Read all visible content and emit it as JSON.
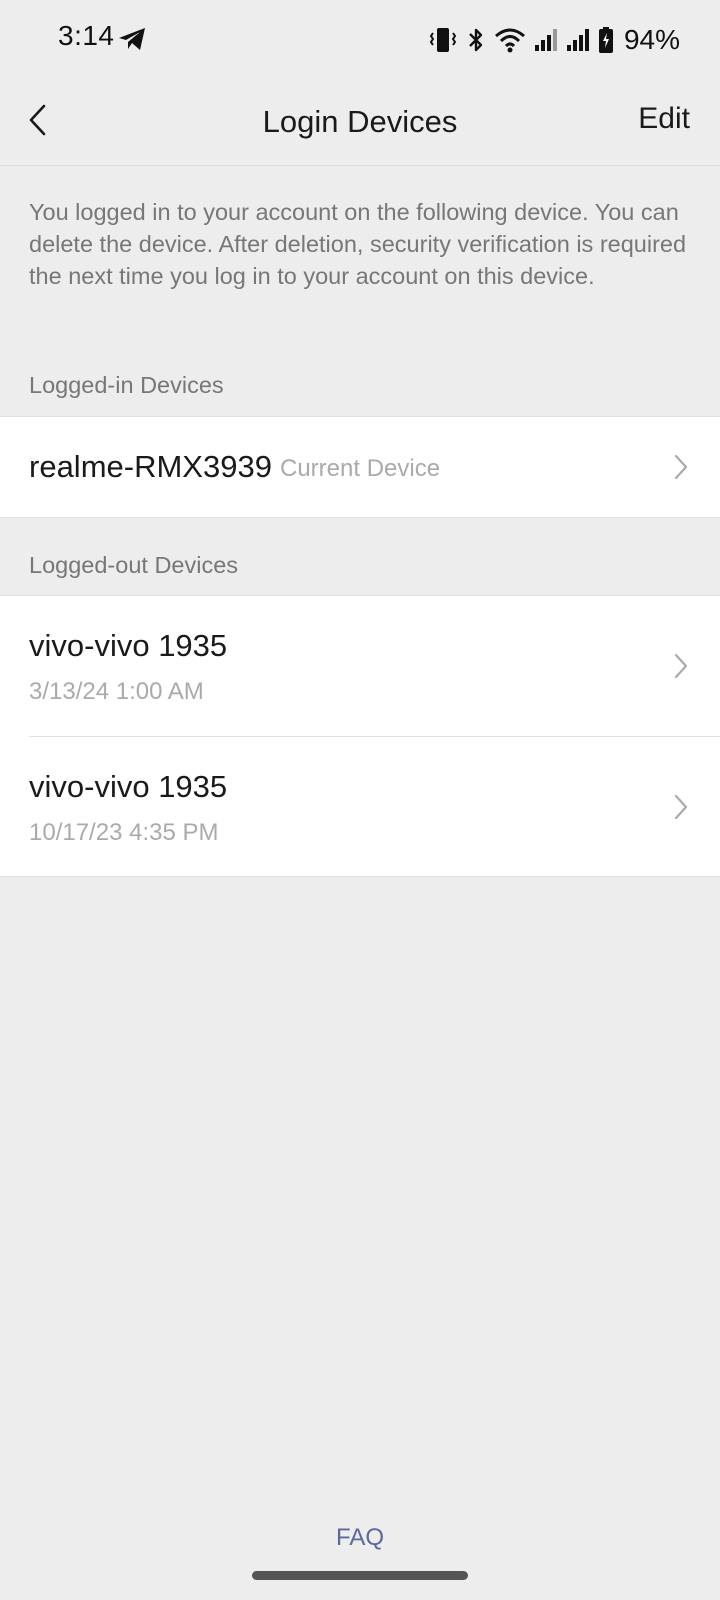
{
  "status_bar": {
    "time": "3:14",
    "battery_percent": "94%",
    "icons": [
      "telegram-icon",
      "vibrate-icon",
      "bluetooth-icon",
      "wifi-icon",
      "signal-icon",
      "signal-icon",
      "battery-charging-icon"
    ]
  },
  "header": {
    "title": "Login Devices",
    "edit_label": "Edit",
    "back_icon": "chevron-left-icon"
  },
  "description": "You logged in to your account on the following device. You can delete the device. After deletion, security verification is required the next time you log in to your account on this device.",
  "logged_in": {
    "section_title": "Logged-in Devices",
    "devices": [
      {
        "name": "realme-RMX3939",
        "tag": "Current Device"
      }
    ]
  },
  "logged_out": {
    "section_title": "Logged-out Devices",
    "devices": [
      {
        "name": "vivo-vivo 1935",
        "time": "3/13/24 1:00 AM"
      },
      {
        "name": "vivo-vivo 1935",
        "time": "10/17/23 4:35 PM"
      }
    ]
  },
  "footer": {
    "faq_label": "FAQ"
  },
  "colors": {
    "background": "#ededed",
    "card": "#ffffff",
    "faq_link": "#5b6a99",
    "secondary_text": "#777777",
    "muted_text": "#aaaaaa"
  }
}
